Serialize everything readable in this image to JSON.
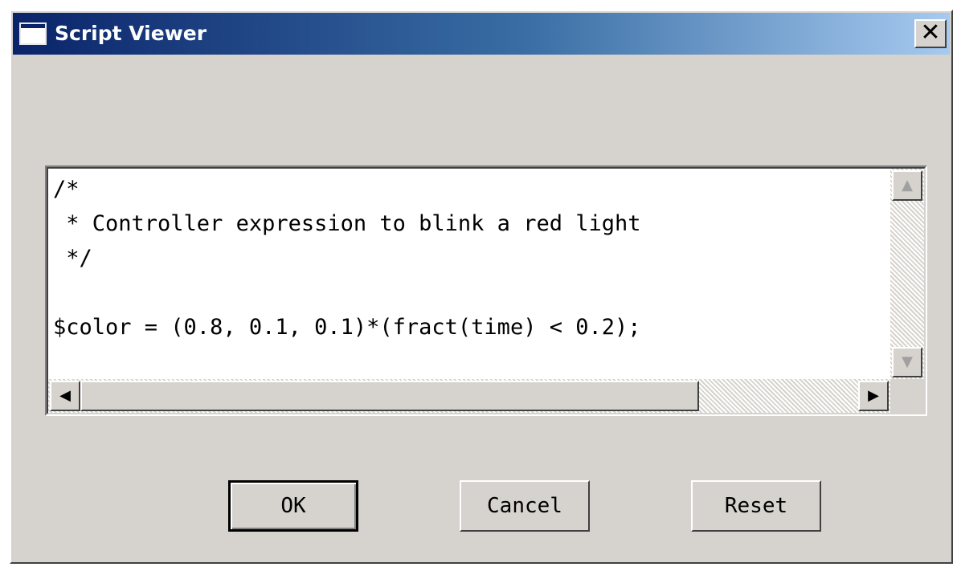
{
  "window": {
    "title": "Script Viewer",
    "close_label": "✕",
    "icon": "window-icon"
  },
  "editor": {
    "lines": [
      "/*",
      " * Controller expression to blink a red light",
      " */",
      "",
      "$color = (0.8, 0.1, 0.1)*(fract(time) < 0.2);"
    ],
    "scroll_up_glyph": "▲",
    "scroll_down_glyph": "▼",
    "scroll_left_glyph": "◀",
    "scroll_right_glyph": "▶"
  },
  "buttons": {
    "ok_label": "OK",
    "cancel_label": "Cancel",
    "reset_label": "Reset"
  },
  "colors": {
    "titlebar_start": "#0a246a",
    "titlebar_end": "#a6caf0",
    "dialog_face": "#d6d3ce"
  }
}
